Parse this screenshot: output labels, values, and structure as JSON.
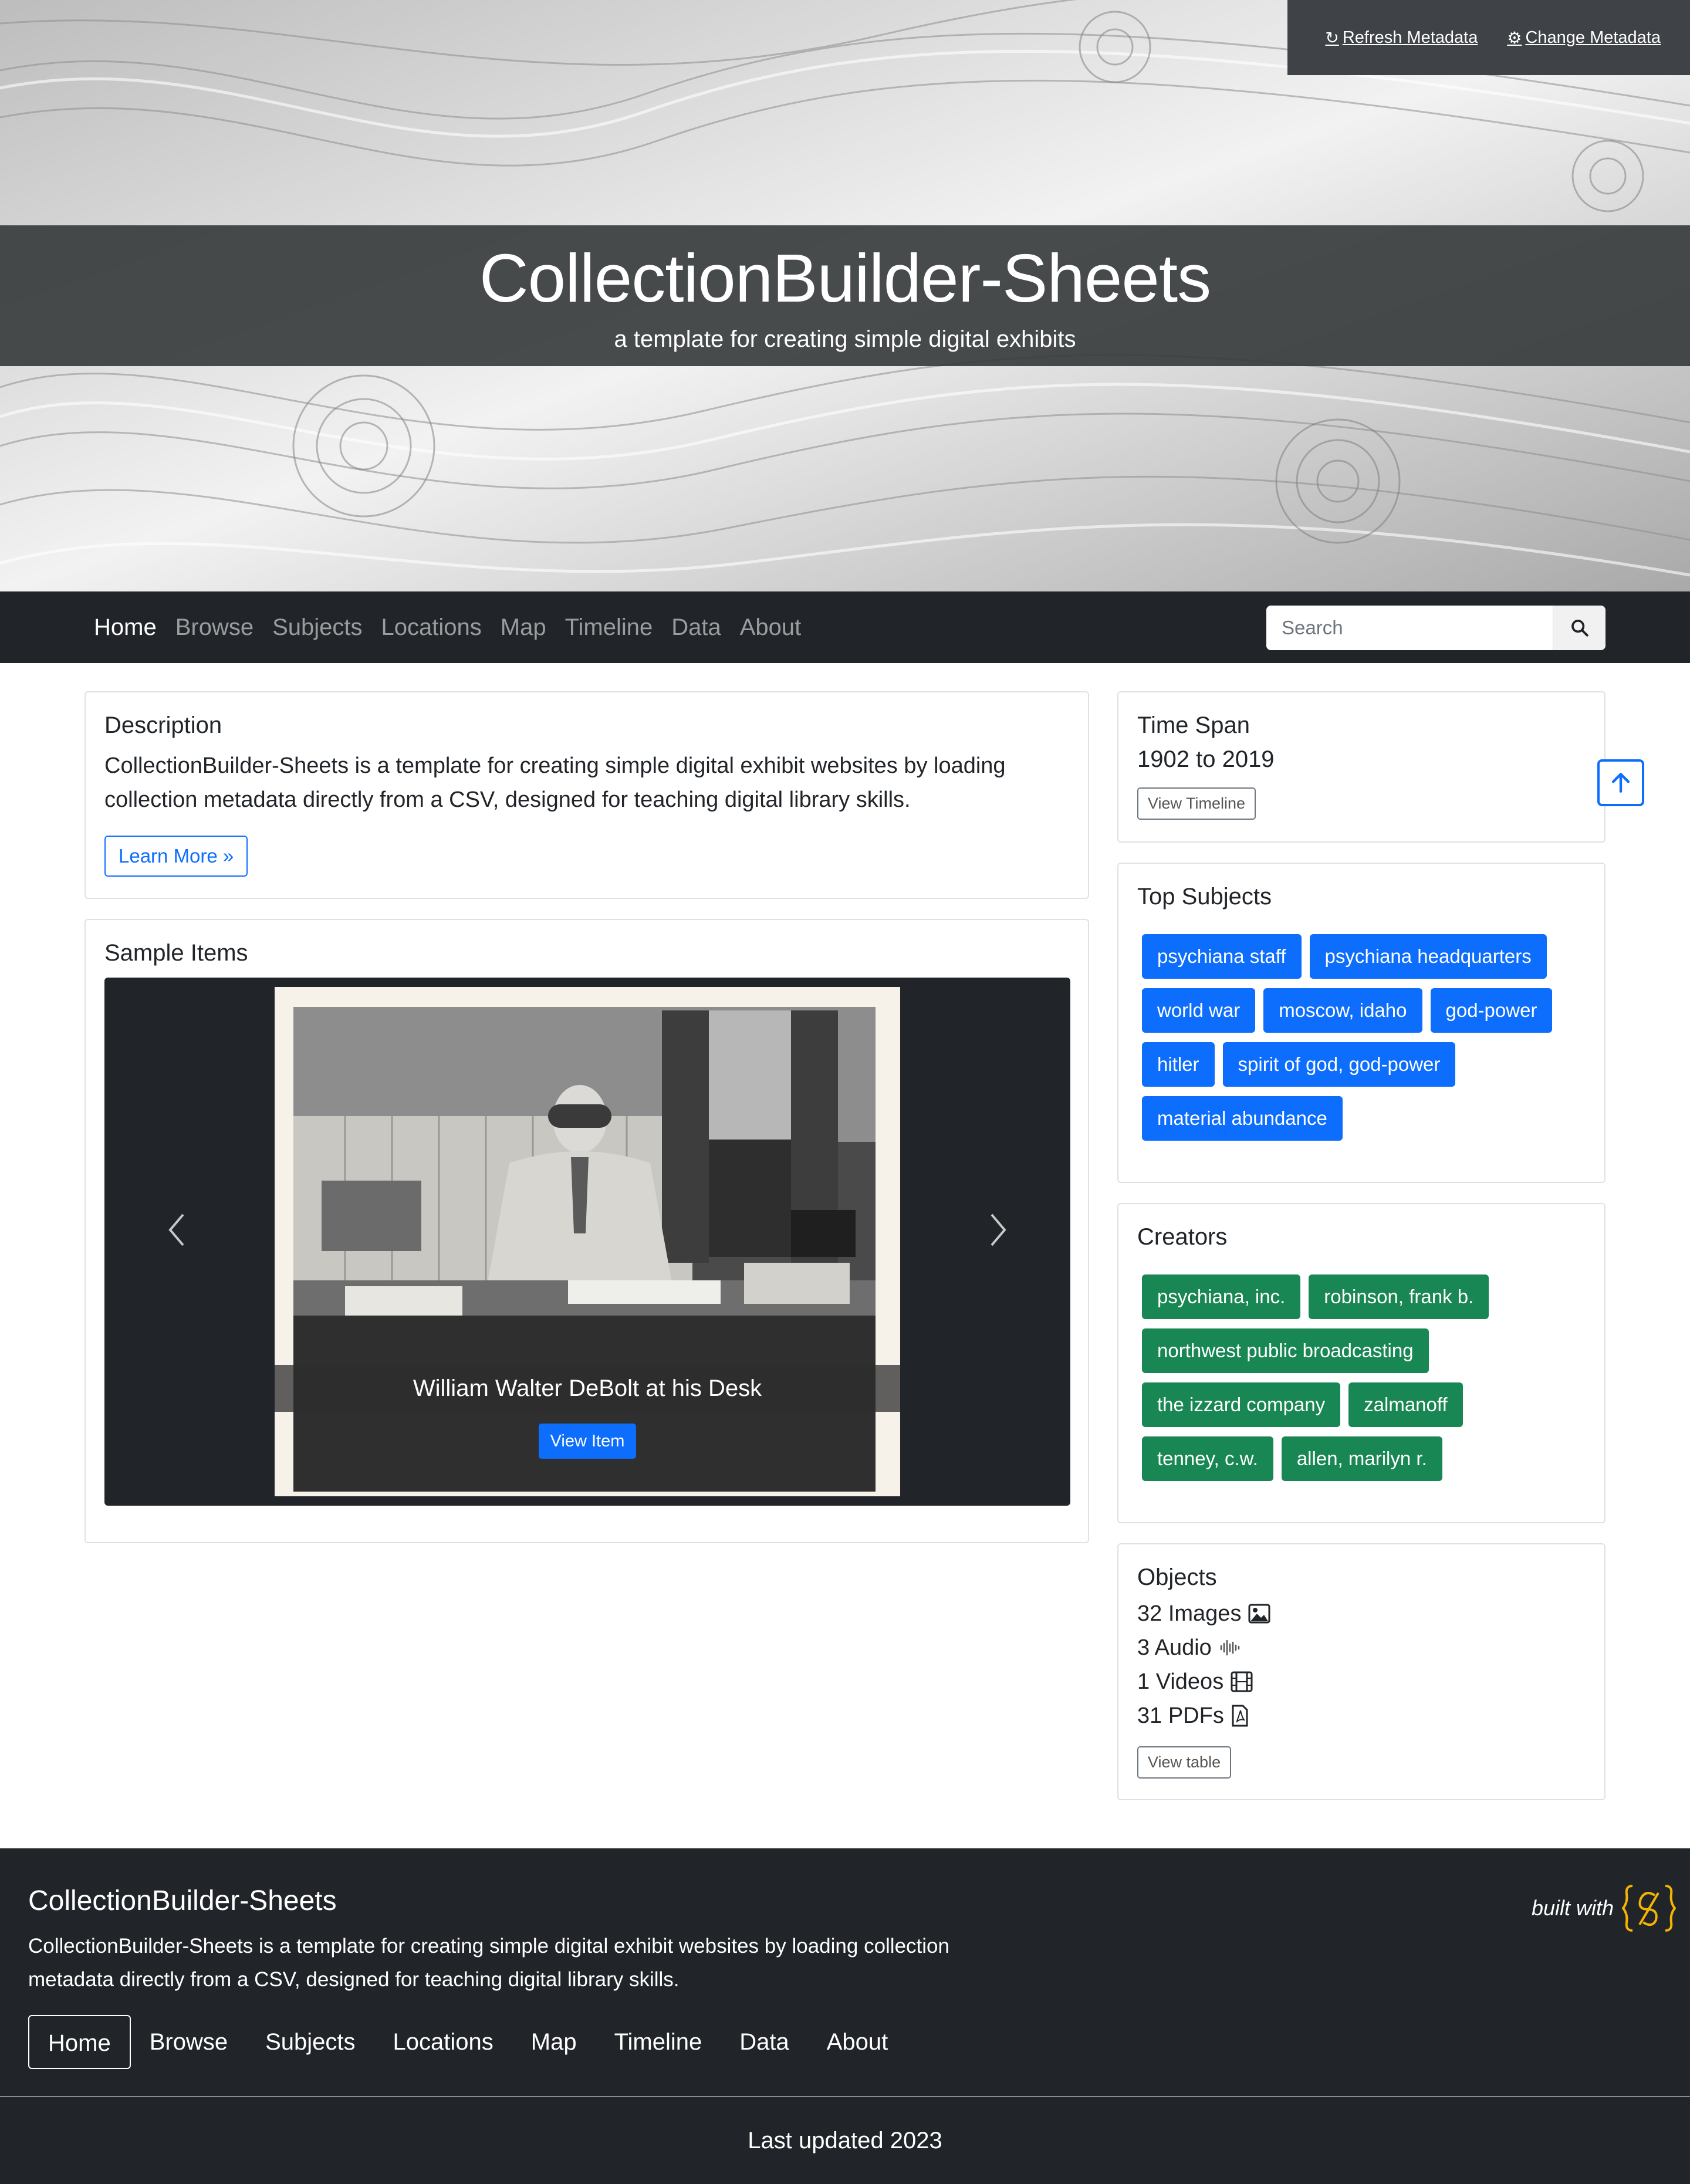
{
  "header": {
    "title": "CollectionBuilder-Sheets",
    "tagline": "a template for creating simple digital exhibits",
    "refresh_label": "Refresh Metadata",
    "change_label": "Change Metadata"
  },
  "nav": {
    "items": [
      "Home",
      "Browse",
      "Subjects",
      "Locations",
      "Map",
      "Timeline",
      "Data",
      "About"
    ],
    "active": "Home",
    "search_placeholder": "Search"
  },
  "description": {
    "heading": "Description",
    "text": "CollectionBuilder-Sheets is a template for creating simple digital exhibit websites by loading collection metadata directly from a CSV, designed for teaching digital library skills.",
    "button": "Learn More »"
  },
  "sample_items": {
    "heading": "Sample Items",
    "caption": "William Walter DeBolt at his Desk",
    "button": "View Item"
  },
  "time_span": {
    "heading": "Time Span",
    "value": "1902 to 2019",
    "button": "View Timeline"
  },
  "top_subjects": {
    "heading": "Top Subjects",
    "items": [
      "psychiana staff",
      "psychiana headquarters",
      "world war",
      "moscow, idaho",
      "god-power",
      "hitler",
      "spirit of god, god-power",
      "material abundance"
    ]
  },
  "creators": {
    "heading": "Creators",
    "items": [
      "psychiana, inc.",
      "robinson, frank b.",
      "northwest public broadcasting",
      "the izzard company",
      "zalmanoff",
      "tenney, c.w.",
      "allen, marilyn r."
    ]
  },
  "objects": {
    "heading": "Objects",
    "images": "32 Images",
    "audio": "3 Audio",
    "videos": "1 Videos",
    "pdfs": "31 PDFs",
    "button": "View table"
  },
  "footer": {
    "title": "CollectionBuilder-Sheets",
    "description": "CollectionBuilder-Sheets is a template for creating simple digital exhibit websites by loading collection metadata directly from a CSV, designed for teaching digital library skills.",
    "nav": [
      "Home",
      "Browse",
      "Subjects",
      "Locations",
      "Map",
      "Timeline",
      "Data",
      "About"
    ],
    "built_with": "built with",
    "last_updated": "Last updated 2023"
  },
  "colors": {
    "primary": "#0d6efd",
    "success": "#198754",
    "dark": "#212529",
    "logo_gold": "#f4b400"
  }
}
